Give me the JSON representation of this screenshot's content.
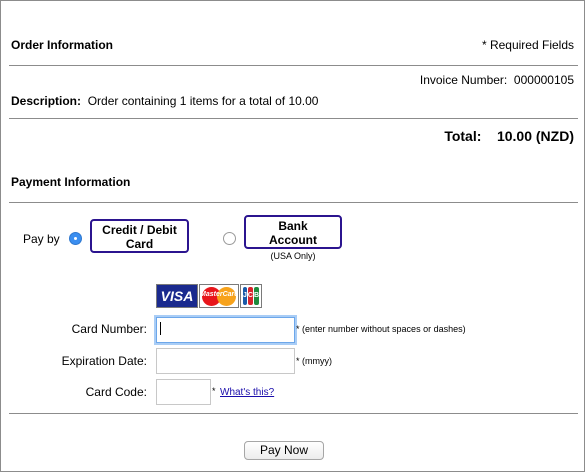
{
  "order": {
    "title": "Order Information",
    "required_note": "* Required Fields",
    "invoice_label": "Invoice Number:",
    "invoice_value": "000000105",
    "description_label": "Description:",
    "description_value": "Order containing 1 items for a total of 10.00",
    "total_label": "Total:",
    "total_value": "10.00 (NZD)"
  },
  "payment": {
    "title": "Payment Information",
    "pay_by_label": "Pay by",
    "options": [
      {
        "label_line1": "Credit / Debit",
        "label_line2": "Card",
        "selected": true
      },
      {
        "label_line1": "Bank",
        "label_line2": "Account",
        "note": "(USA Only)",
        "selected": false
      }
    ],
    "card_logos": [
      "VISA",
      "MasterCard",
      "JCB"
    ],
    "card_number_label": "Card Number:",
    "card_number_value": "",
    "card_number_hint": "* (enter number without spaces or dashes)",
    "expiration_label": "Expiration Date:",
    "expiration_value": "",
    "expiration_hint": "* (mmyy)",
    "card_code_label": "Card Code:",
    "card_code_value": "",
    "card_code_asterisk": "*",
    "whats_this": "What's this?",
    "submit_label": "Pay Now"
  },
  "colors": {
    "border": "#8c8c8c",
    "accent_blue": "#3a8ef0",
    "button_outline": "#2b148f",
    "link": "#1a0dab"
  }
}
